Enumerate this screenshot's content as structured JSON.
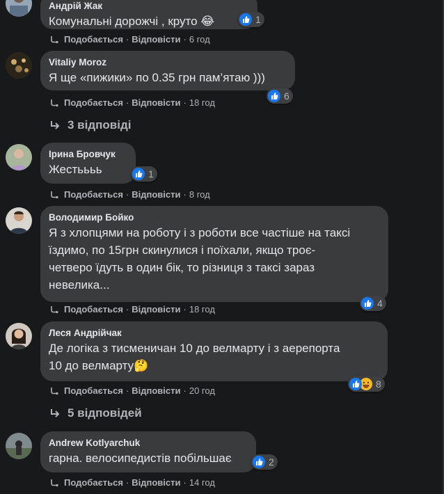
{
  "colors": {
    "background": "#18191a",
    "bubble": "#3a3b3c",
    "text": "#e4e6eb",
    "muted": "#b0b3b8",
    "like_blue": "#1877f2",
    "haha_yellow": "#f7b928"
  },
  "actions": {
    "like_label": "Подобається",
    "reply_label": "Відповісти",
    "separator": "·"
  },
  "comments": [
    {
      "author": "Андрій Жак",
      "text": "Комунальні дорожчі , круто 😂",
      "reactions": [
        "like-icon"
      ],
      "reaction_count": "1",
      "time": "6 год"
    },
    {
      "author": "Vitaliy Moroz",
      "text": "Я ще «пижики» по 0.35 грн пам’ятаю )))",
      "reactions": [
        "like-icon"
      ],
      "reaction_count": "6",
      "time": "18 год",
      "replies_label": "3 відповіді"
    },
    {
      "author": "Ірина Бровчук",
      "text": "Жестьььь",
      "reactions": [
        "like-icon"
      ],
      "reaction_count": "1",
      "time": "8 год"
    },
    {
      "author": "Володимир Бойко",
      "text_lines": [
        "Я з хлопцями на роботу і з роботи все частіше на таксі",
        "їздимо, по 15грн скинулися і поїхали, якщо троє-",
        "четверо їдуть в один бік, то різниця з таксі зараз",
        "невелика..."
      ],
      "reactions": [
        "like-icon"
      ],
      "reaction_count": "4",
      "time": "18 год"
    },
    {
      "author": "Леся Андрійчак",
      "text_lines": [
        "Де логіка з тисменичан 10 до велмарту і з аерепорта",
        "10 до велмарту🤔"
      ],
      "reactions": [
        "like-icon",
        "haha-icon"
      ],
      "reaction_count": "8",
      "time": "20 год",
      "replies_label": "5 відповідей"
    },
    {
      "author": "Andrew Kotlyarchuk",
      "text": "гарна. велосипедистів побільшає",
      "reactions": [
        "like-icon"
      ],
      "reaction_count": "2",
      "time": "14 год"
    }
  ]
}
